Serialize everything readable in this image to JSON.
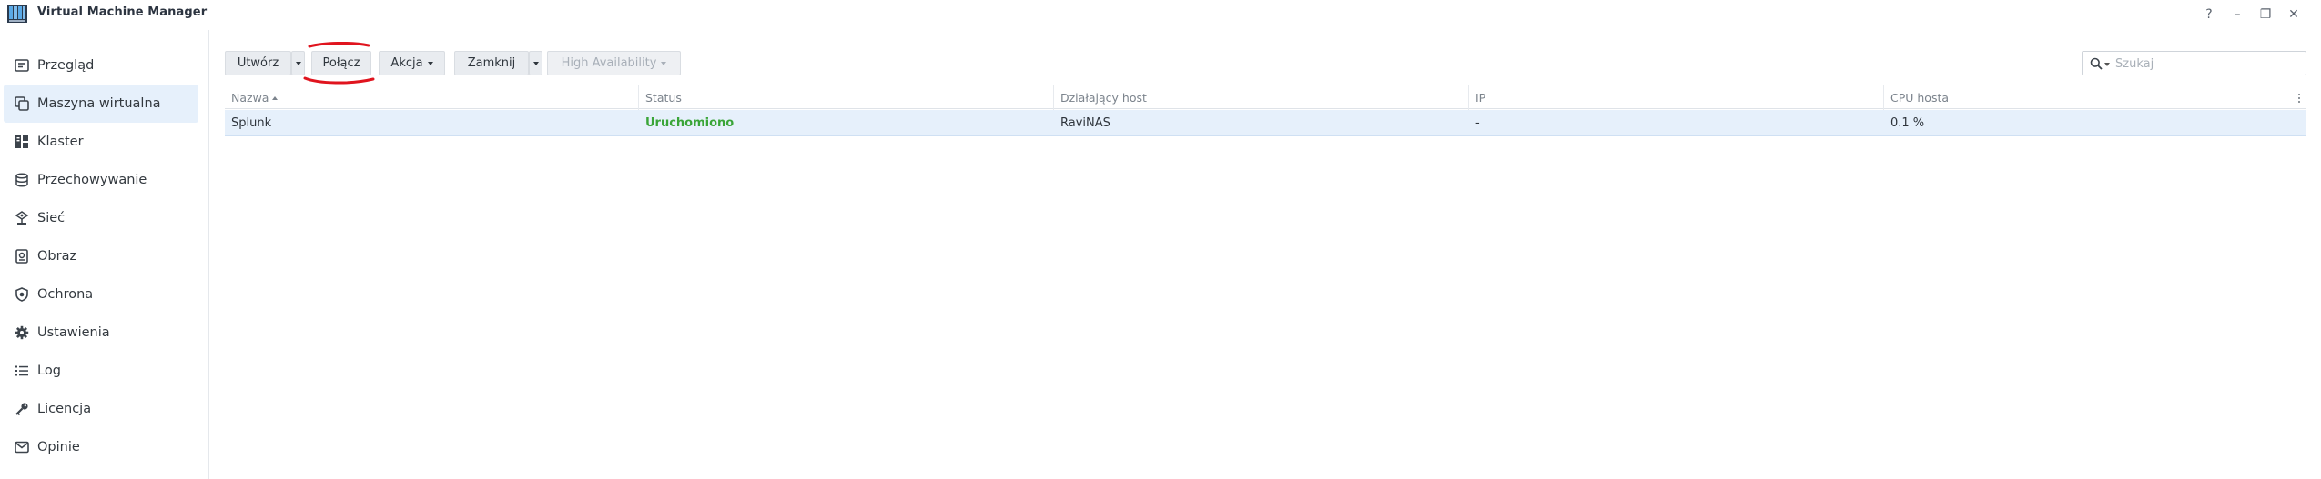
{
  "app": {
    "title": "Virtual Machine Manager",
    "window_controls": {
      "help": "?",
      "minimize": "–",
      "restore": "❐",
      "close": "✕"
    }
  },
  "sidebar": {
    "items": [
      {
        "label": "Przegląd",
        "icon": "overview-icon",
        "active": false
      },
      {
        "label": "Maszyna wirtualna",
        "icon": "virtual-machine-icon",
        "active": true
      },
      {
        "label": "Klaster",
        "icon": "cluster-icon",
        "active": false
      },
      {
        "label": "Przechowywanie",
        "icon": "storage-icon",
        "active": false
      },
      {
        "label": "Sieć",
        "icon": "network-icon",
        "active": false
      },
      {
        "label": "Obraz",
        "icon": "image-icon",
        "active": false
      },
      {
        "label": "Ochrona",
        "icon": "protection-icon",
        "active": false
      },
      {
        "label": "Ustawienia",
        "icon": "settings-icon",
        "active": false
      },
      {
        "label": "Log",
        "icon": "log-icon",
        "active": false
      },
      {
        "label": "Licencja",
        "icon": "license-icon",
        "active": false
      },
      {
        "label": "Opinie",
        "icon": "feedback-icon",
        "active": false
      }
    ]
  },
  "toolbar": {
    "create_label": "Utwórz",
    "connect_label": "Połącz",
    "action_label": "Akcja",
    "shutdown_label": "Zamknij",
    "ha_label": "High Availability",
    "search_placeholder": "Szukaj"
  },
  "table": {
    "columns": [
      "Nazwa",
      "Status",
      "Działający host",
      "IP",
      "CPU hosta"
    ],
    "sorted_column": "Nazwa",
    "rows": [
      {
        "name": "Splunk",
        "status": "Uruchomiono",
        "host": "RaviNAS",
        "ip": "-",
        "cpu": "0.1 %"
      }
    ]
  },
  "colors": {
    "accent": "#e6f0fb",
    "status_running": "#3aa538",
    "annotation": "#e0141e"
  }
}
